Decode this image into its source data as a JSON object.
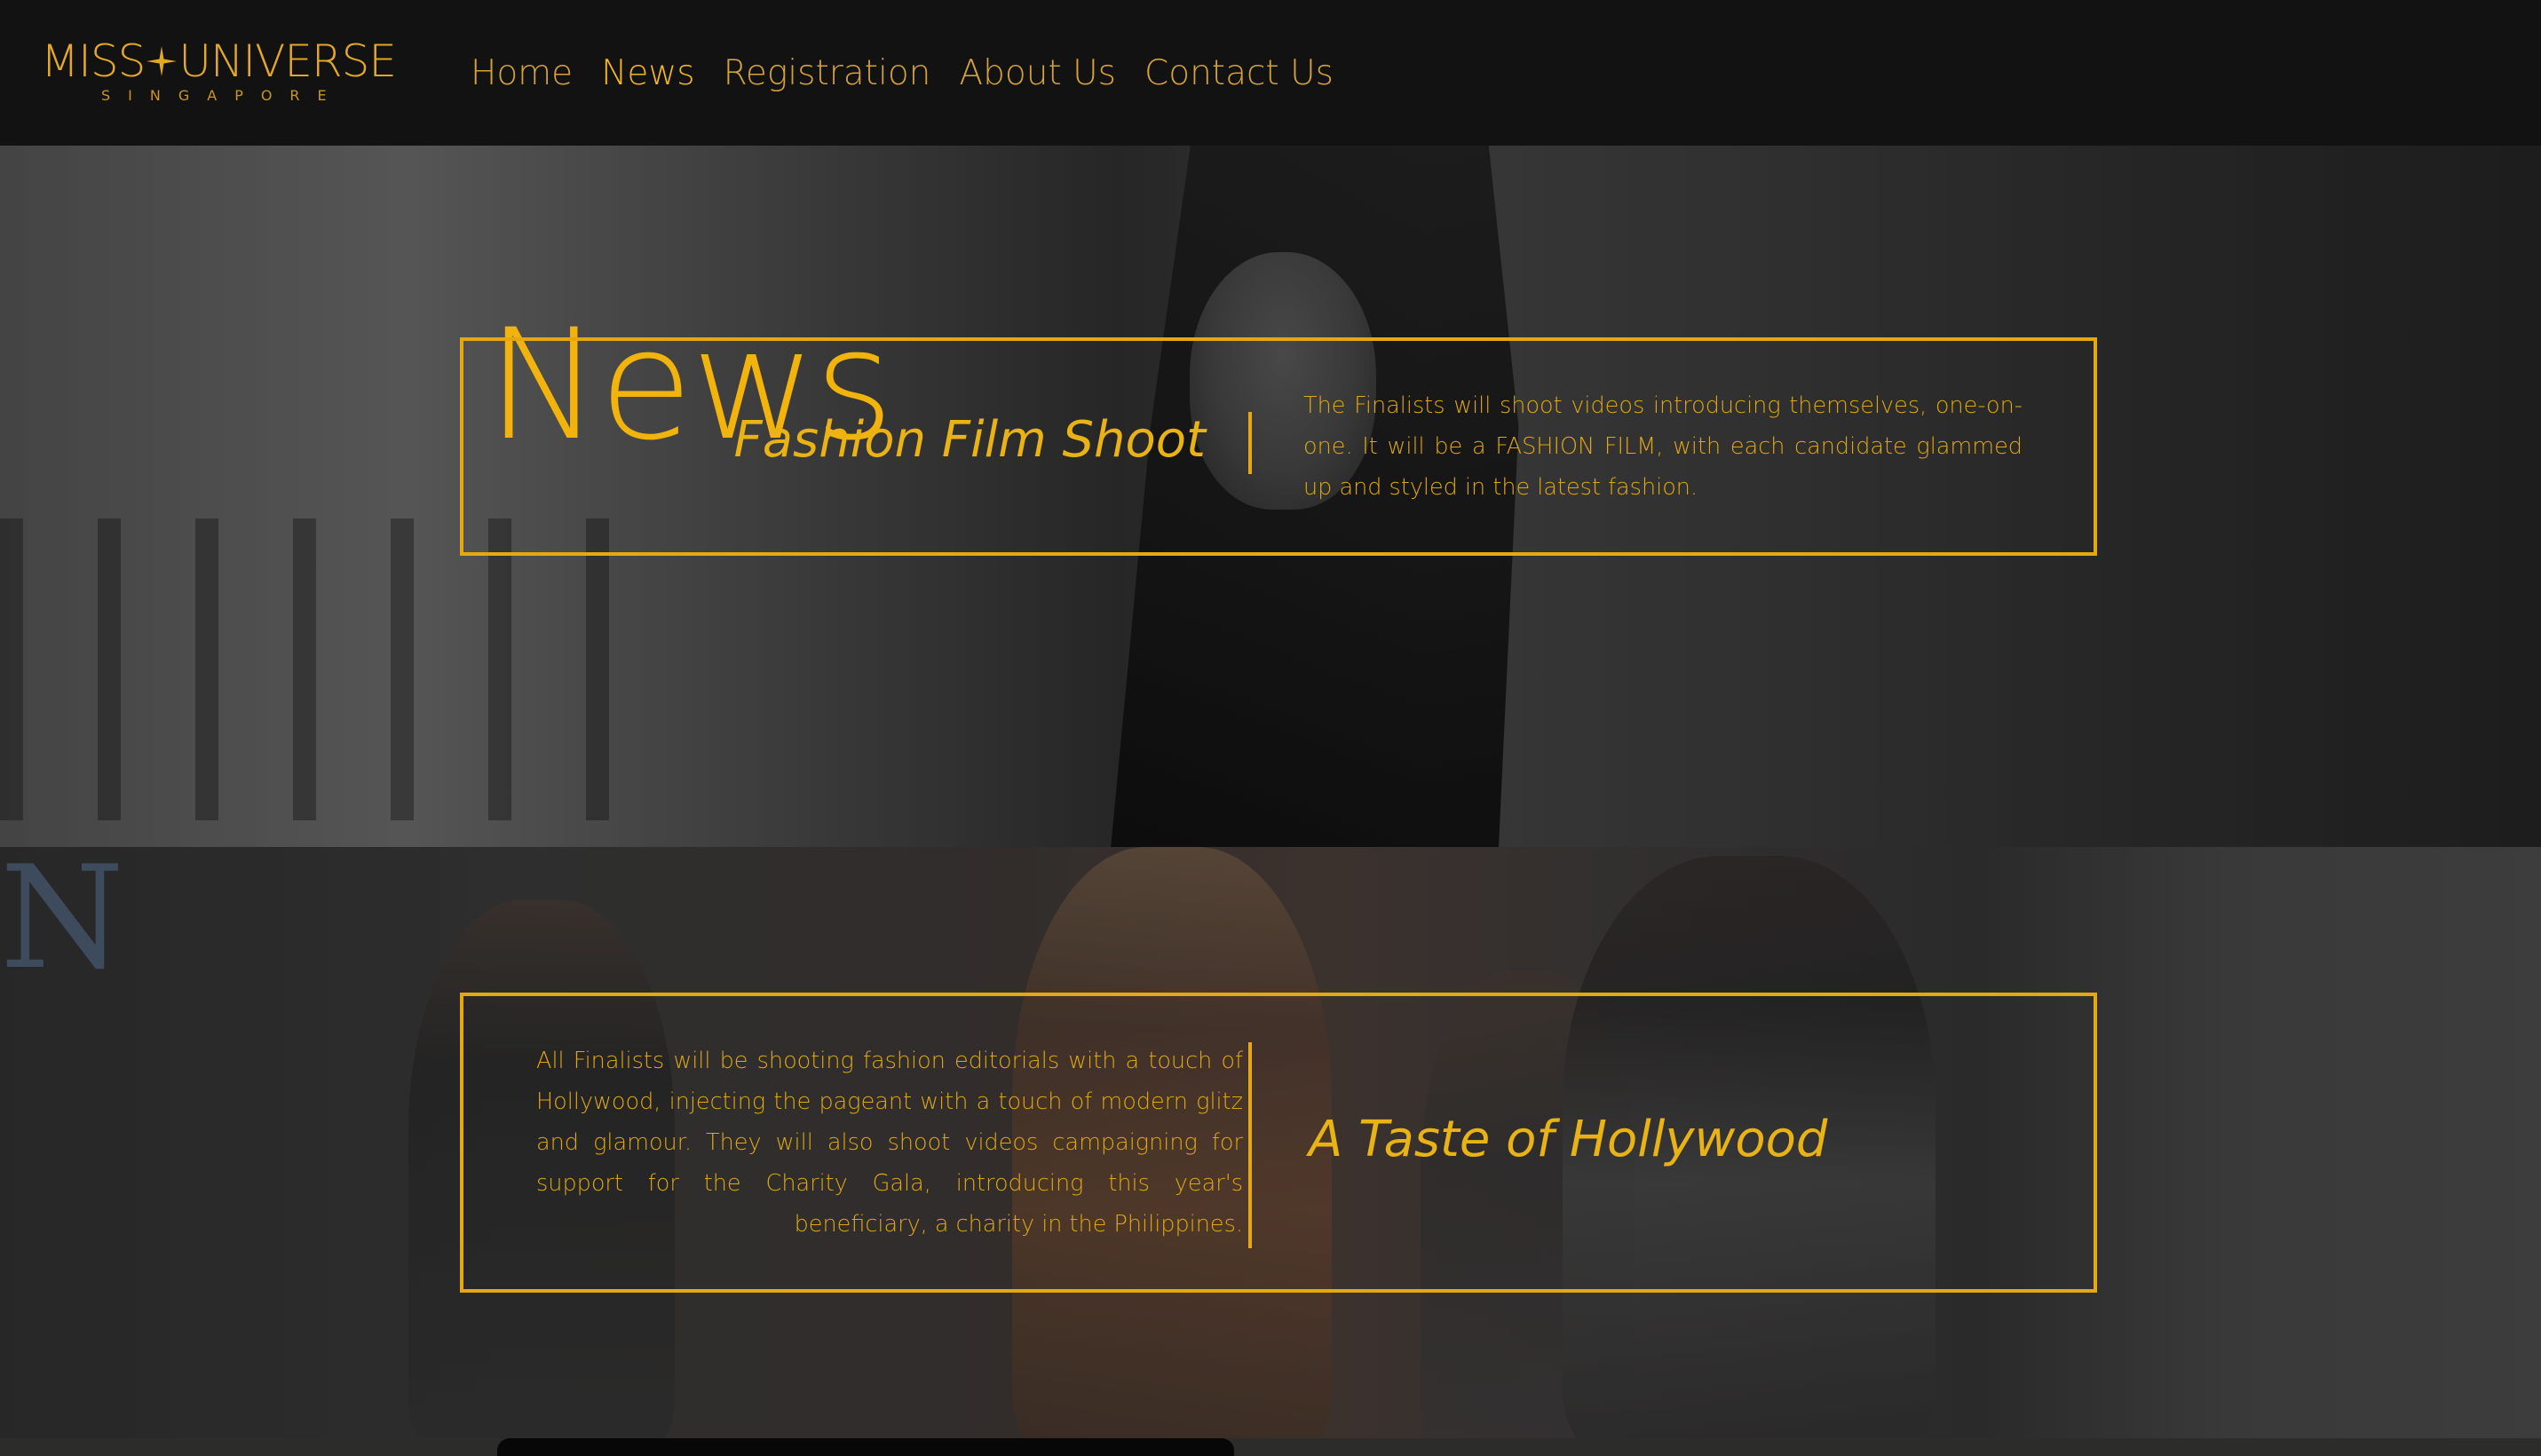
{
  "brand": {
    "logo_main_left": "MISS",
    "logo_main_right": "UNIVERSE",
    "logo_sub": "SINGAPORE",
    "accent_color": "#f2b30c"
  },
  "nav": {
    "items": [
      {
        "label": "Home",
        "active": false
      },
      {
        "label": "News",
        "active": true
      },
      {
        "label": "Registration",
        "active": false
      },
      {
        "label": "About Us",
        "active": false
      },
      {
        "label": "Contact Us",
        "active": false
      }
    ]
  },
  "page": {
    "title": "News"
  },
  "articles": [
    {
      "heading": "Fashion Film Shoot",
      "body": "The Finalists will shoot videos introducing themselves, one-on-one. It will be a FASHION FILM, with each candidate glammed up and styled in the latest fashion."
    },
    {
      "heading": "A Taste of Hollywood",
      "body": "All Finalists will be shooting fashion editorials with a touch of Hollywood, injecting the pageant with a touch of modern glitz and glamour. They will also shoot videos campaigning for support for the Charity Gala, introducing this year's beneficiary, a charity in the Philippines."
    }
  ]
}
